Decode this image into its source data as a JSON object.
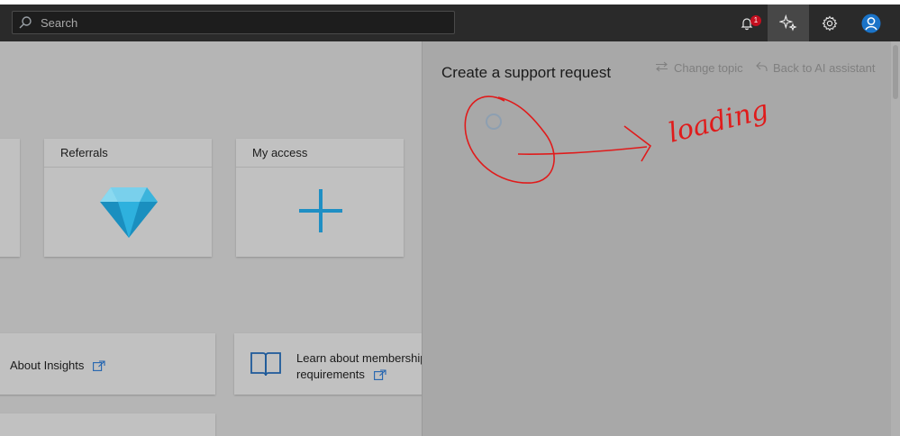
{
  "header": {
    "search_placeholder": "Search",
    "notification_count": "1"
  },
  "cards": [
    {
      "title": "Referrals",
      "icon": "diamond-icon"
    },
    {
      "title": "My access",
      "icon": "plus-icon"
    }
  ],
  "links": [
    {
      "label": "About Insights"
    },
    {
      "label_line1": "Learn about membership",
      "label_line2": "requirements"
    }
  ],
  "panel": {
    "title": "Create a support request",
    "change_topic": "Change topic",
    "back_to_ai": "Back to AI assistant"
  },
  "annotation": {
    "handwritten_text": "loading",
    "color": "#e01b1b"
  },
  "colors": {
    "topbar": "#2a2a2a",
    "accent": "#1a73c8",
    "badge": "#c50f1f"
  }
}
